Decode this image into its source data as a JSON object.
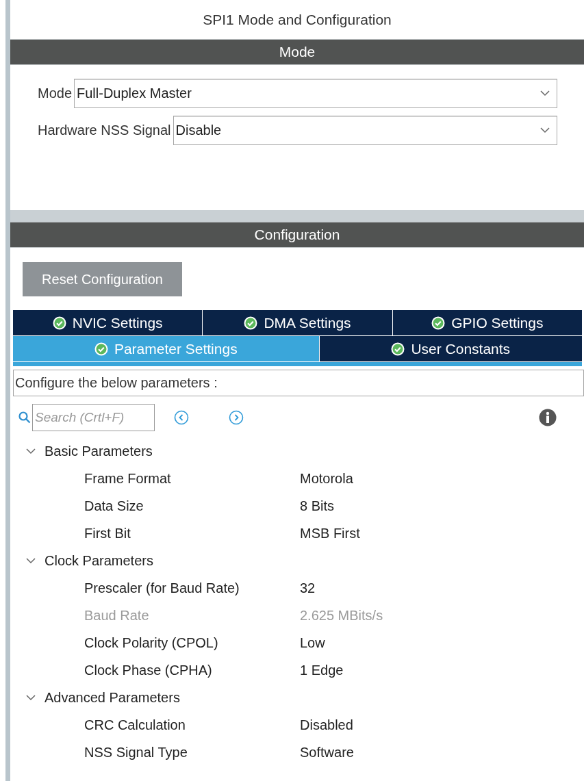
{
  "title": "SPI1 Mode and Configuration",
  "mode_section": {
    "header": "Mode",
    "fields": [
      {
        "label": "Mode",
        "value": "Full-Duplex Master"
      },
      {
        "label": "Hardware NSS Signal",
        "value": "Disable"
      }
    ]
  },
  "configuration_section": {
    "header": "Configuration",
    "reset_button": "Reset Configuration",
    "tab_rows": [
      {
        "tabs": [
          {
            "label": "NVIC Settings",
            "selected": false
          },
          {
            "label": "DMA Settings",
            "selected": false
          },
          {
            "label": "GPIO Settings",
            "selected": false
          }
        ]
      },
      {
        "tabs": [
          {
            "label": "Parameter Settings",
            "selected": true
          },
          {
            "label": "User Constants",
            "selected": false
          }
        ]
      }
    ],
    "description": "Configure the below parameters :",
    "search": {
      "placeholder": "Search (Crtl+F)"
    },
    "parameters": [
      {
        "label": "Basic Parameters",
        "expanded": true,
        "children": [
          {
            "name": "Frame Format",
            "value": "Motorola",
            "disabled": false
          },
          {
            "name": "Data Size",
            "value": "8 Bits",
            "disabled": false
          },
          {
            "name": "First Bit",
            "value": "MSB First",
            "disabled": false
          }
        ]
      },
      {
        "label": "Clock Parameters",
        "expanded": true,
        "children": [
          {
            "name": "Prescaler (for Baud Rate)",
            "value": "32",
            "disabled": false
          },
          {
            "name": "Baud Rate",
            "value": "2.625 MBits/s",
            "disabled": true
          },
          {
            "name": "Clock Polarity (CPOL)",
            "value": "Low",
            "disabled": false
          },
          {
            "name": "Clock Phase (CPHA)",
            "value": "1 Edge",
            "disabled": false
          }
        ]
      },
      {
        "label": "Advanced Parameters",
        "expanded": true,
        "children": [
          {
            "name": "CRC Calculation",
            "value": "Disabled",
            "disabled": false
          },
          {
            "name": "NSS Signal Type",
            "value": "Software",
            "disabled": false
          }
        ]
      }
    ]
  }
}
